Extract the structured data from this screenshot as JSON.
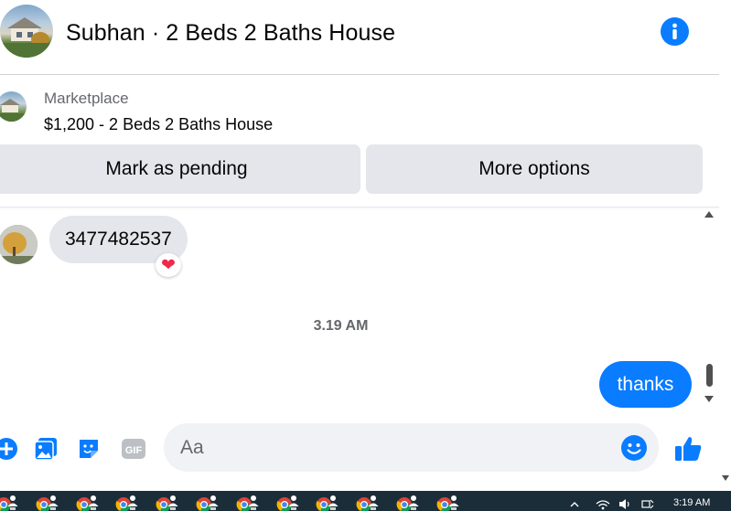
{
  "header": {
    "title": "Subhan · 2 Beds 2 Baths House",
    "info_icon": "info-icon"
  },
  "listing": {
    "label": "Marketplace",
    "title": "$1,200 - 2 Beds 2 Baths House"
  },
  "actions": {
    "mark_pending": "Mark as pending",
    "more_options": "More options"
  },
  "messages": {
    "incoming": {
      "text": "3477482537",
      "reaction": "❤"
    },
    "timestamp": "3.19 AM",
    "outgoing": {
      "text": "thanks"
    }
  },
  "composer": {
    "placeholder": "Aa",
    "icons": [
      "plus-icon",
      "image-icon",
      "sticker-icon",
      "gif-icon",
      "emoji-icon",
      "like-icon"
    ]
  },
  "taskbar": {
    "time": "3:19 AM",
    "app_icon": "chrome-user-icon",
    "app_count": 12
  },
  "colors": {
    "accent": "#0a7cff",
    "bubble_in": "#e4e6eb",
    "button_bg": "#e4e6eb",
    "taskbar": "#1c2d3a",
    "reaction": "#f02849"
  }
}
